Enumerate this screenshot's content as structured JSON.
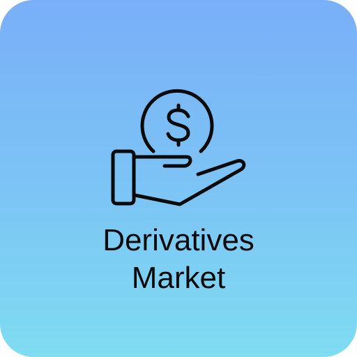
{
  "app_icon": {
    "label_line1": "Derivatives",
    "label_line2": "Market",
    "icon": "hand-holding-dollar-icon",
    "colors": {
      "gradient_top": "#79aff8",
      "gradient_bottom": "#7fdcf1",
      "foreground": "#0a0a0a"
    }
  }
}
